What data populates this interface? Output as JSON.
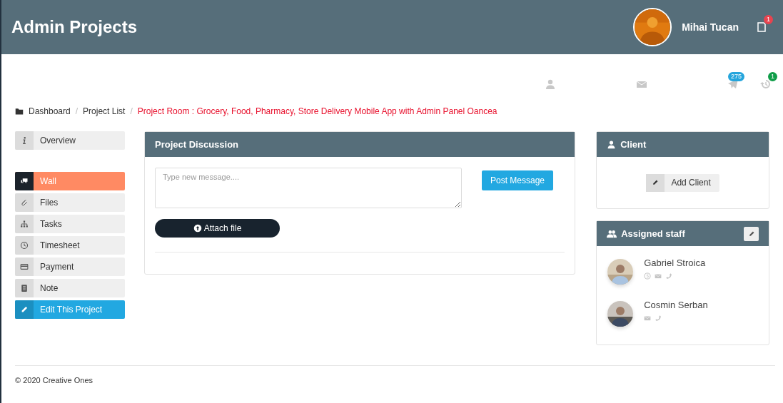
{
  "header": {
    "title": "Admin Projects",
    "user": {
      "name": "Mihai Tucan"
    },
    "notifications": {
      "badge": "1",
      "color": "#e8434f"
    }
  },
  "toolbar": [
    {
      "kind": "user"
    },
    {
      "kind": "mail"
    },
    {
      "kind": "plane",
      "badge": "275",
      "color": "#25a5dc"
    },
    {
      "kind": "history",
      "badge": "1",
      "color": "#0f9d48"
    }
  ],
  "breadcrumb_separator": "/",
  "breadcrumb": [
    {
      "label": "Dashboard",
      "current": false
    },
    {
      "label": "Project List",
      "current": false
    },
    {
      "label": "Project Room : Grocery, Food, Pharmacy, Store Delivery Mobile App with Admin Panel Oancea",
      "current": true
    }
  ],
  "sidebar": {
    "top": [
      {
        "label": "Overview",
        "kind": "info",
        "selected": false
      }
    ],
    "items": [
      {
        "label": "Wall",
        "kind": "chat",
        "selected": true
      },
      {
        "label": "Files",
        "kind": "clip",
        "selected": false
      },
      {
        "label": "Tasks",
        "kind": "tree",
        "selected": false
      },
      {
        "label": "Timesheet",
        "kind": "clock",
        "selected": false
      },
      {
        "label": "Payment",
        "kind": "card",
        "selected": false
      },
      {
        "label": "Note",
        "kind": "note",
        "selected": false
      },
      {
        "label": "Edit This Project",
        "kind": "edit",
        "selected": false
      }
    ]
  },
  "discussion": {
    "title": "Project Discussion",
    "message": {
      "placeholder": "Type new message...."
    },
    "post_button": "Post Message",
    "attach_button": "Attach file"
  },
  "client": {
    "title": "Client",
    "add_button": "Add Client"
  },
  "staff": {
    "title": "Assigned staff",
    "members": [
      {
        "name": "Gabriel Stroica",
        "contacts": [
          {
            "kind": "skype"
          },
          {
            "kind": "mail"
          },
          {
            "kind": "phone"
          }
        ]
      },
      {
        "name": "Cosmin Serban",
        "contacts": [
          {
            "kind": "mail"
          },
          {
            "kind": "phone"
          }
        ]
      }
    ]
  },
  "footer": "© 2020 Creative Ones"
}
